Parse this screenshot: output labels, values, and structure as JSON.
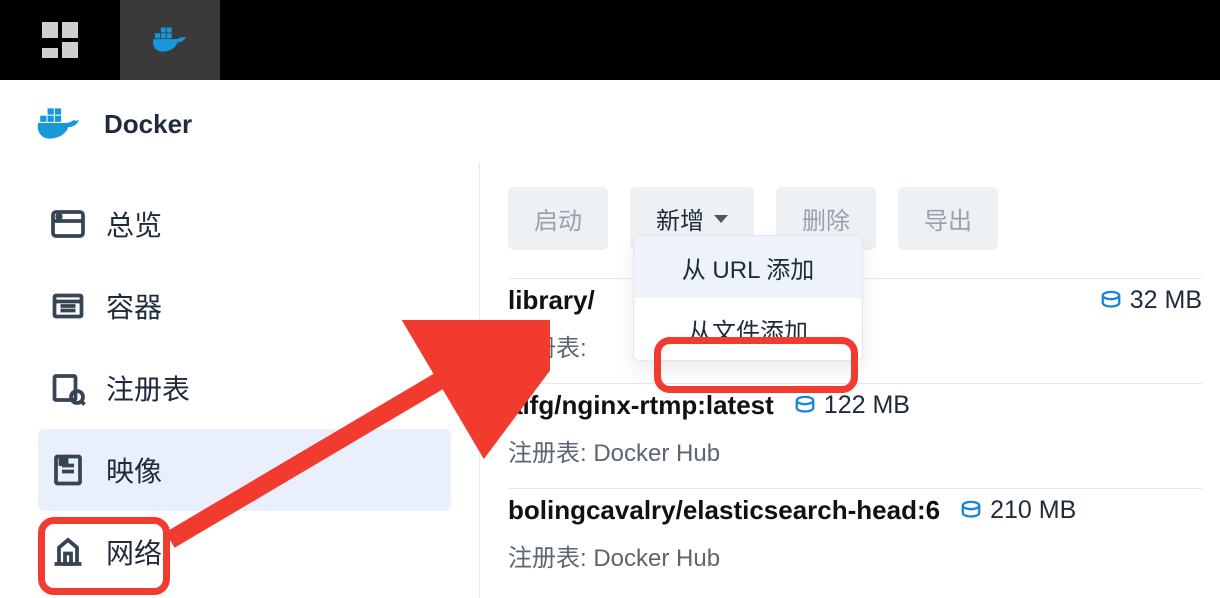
{
  "taskbar": {
    "icons": [
      "grid-icon",
      "docker-icon"
    ]
  },
  "app": {
    "title": "Docker"
  },
  "sidebar": {
    "items": [
      {
        "id": "overview",
        "label": "总览",
        "icon": "overview-icon"
      },
      {
        "id": "container",
        "label": "容器",
        "icon": "container-icon"
      },
      {
        "id": "registry",
        "label": "注册表",
        "icon": "registry-icon"
      },
      {
        "id": "image",
        "label": "映像",
        "icon": "image-icon",
        "active": true
      },
      {
        "id": "network",
        "label": "网络",
        "icon": "network-icon"
      }
    ]
  },
  "toolbar": {
    "start_label": "启动",
    "add_label": "新增",
    "delete_label": "删除",
    "export_label": "导出"
  },
  "dropdown": {
    "items": [
      {
        "id": "add-from-url",
        "label": "从 URL 添加"
      },
      {
        "id": "add-from-file",
        "label": "从文件添加"
      }
    ]
  },
  "images": [
    {
      "name": "library/",
      "size_text": "32 MB",
      "registry_label": "注册表:",
      "registry": ""
    },
    {
      "name": "alfg/nginx-rtmp:latest",
      "size_text": "122 MB",
      "registry_label": "注册表:",
      "registry": "Docker Hub"
    },
    {
      "name": "bolingcavalry/elasticsearch-head:6",
      "size_text": "210 MB",
      "registry_label": "注册表:",
      "registry": "Docker Hub"
    }
  ],
  "annotations": {
    "highlight_sidebar_item": "image",
    "highlight_dropdown_item": "add-from-url",
    "arrow_color": "#f23b2f"
  }
}
